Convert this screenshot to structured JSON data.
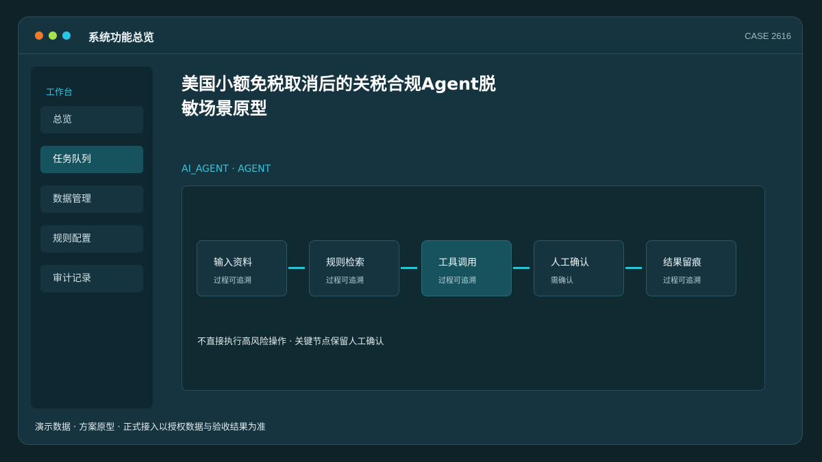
{
  "window": {
    "app_title": "系统功能总览",
    "case_id": "CASE 2616",
    "traffic_lights": [
      "#f07a2a",
      "#a7e34a",
      "#29c9e6"
    ]
  },
  "sidebar": {
    "heading": "工作台",
    "items": [
      {
        "label": "总览",
        "active": false
      },
      {
        "label": "任务队列",
        "active": true
      },
      {
        "label": "数据管理",
        "active": false
      },
      {
        "label": "规则配置",
        "active": false
      },
      {
        "label": "审计记录",
        "active": false
      }
    ]
  },
  "main": {
    "title": "美国小额免税取消后的关税合规Agent脱敏场景原型",
    "section_label": "AI_AGENT · AGENT",
    "flow": {
      "steps": [
        {
          "title": "输入资料",
          "subtitle": "过程可追溯",
          "active": false
        },
        {
          "title": "规则检索",
          "subtitle": "过程可追溯",
          "active": false
        },
        {
          "title": "工具调用",
          "subtitle": "过程可追溯",
          "active": true
        },
        {
          "title": "人工确认",
          "subtitle": "需确认",
          "active": false
        },
        {
          "title": "结果留痕",
          "subtitle": "过程可追溯",
          "active": false
        }
      ],
      "note": "不直接执行高风险操作 · 关键节点保留人工确认"
    }
  },
  "footer": {
    "note": "演示数据 · 方案原型 · 正式接入以授权数据与验收结果为准"
  },
  "colors": {
    "accent": "#33c7dc",
    "connector": "#27c3d7",
    "active_fill": "#17535f"
  }
}
